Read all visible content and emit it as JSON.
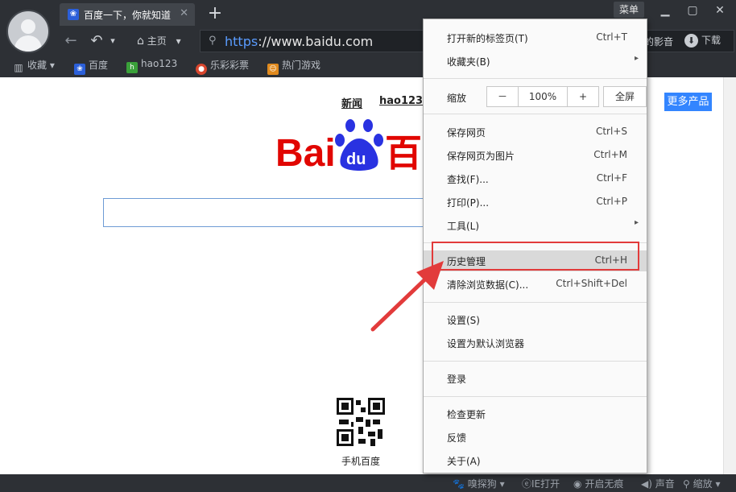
{
  "tab": {
    "title": "百度一下，你就知道",
    "close": "✕"
  },
  "newtab": "+",
  "window": {
    "menu_label": "菜单",
    "min": "▁",
    "max": "▢",
    "close": "✕"
  },
  "nav": {
    "back": "←",
    "undo": "↶",
    "undo_drop": "▾",
    "home_label": "主页",
    "home_drop": "▾"
  },
  "address": {
    "scheme": "https",
    "rest": "://www.baidu.com"
  },
  "toolbar_right": {
    "yingyin": "的影音",
    "download": "下载"
  },
  "bookmarks": [
    {
      "label": "收藏",
      "drop": "▾"
    },
    {
      "label": "百度"
    },
    {
      "label": "hao123"
    },
    {
      "label": "乐彩彩票"
    },
    {
      "label": "热门游戏"
    }
  ],
  "page": {
    "links": {
      "news": "新闻",
      "hao123": "hao123"
    },
    "more_products": "更多产品",
    "qr_label": "手机百度"
  },
  "menu": {
    "items": [
      {
        "label": "打开新的标签页(T)",
        "shortcut": "Ctrl+T"
      },
      {
        "label": "收藏夹(B)",
        "arrow": "▸"
      },
      {
        "label": "缩放",
        "zoom_minus": "－",
        "zoom_value": "100%",
        "zoom_plus": "+",
        "fullscreen": "全屏"
      },
      {
        "label": "保存网页",
        "shortcut": "Ctrl+S"
      },
      {
        "label": "保存网页为图片",
        "shortcut": "Ctrl+M"
      },
      {
        "label": "查找(F)...",
        "shortcut": "Ctrl+F"
      },
      {
        "label": "打印(P)...",
        "shortcut": "Ctrl+P"
      },
      {
        "label": "工具(L)",
        "arrow": "▸"
      },
      {
        "label": "历史管理",
        "shortcut": "Ctrl+H"
      },
      {
        "label": "清除浏览数据(C)...",
        "shortcut": "Ctrl+Shift+Del"
      },
      {
        "label": "设置(S)"
      },
      {
        "label": "设置为默认浏览器"
      },
      {
        "label": "登录"
      },
      {
        "label": "检查更新"
      },
      {
        "label": "反馈"
      },
      {
        "label": "关于(A)"
      }
    ]
  },
  "status": {
    "s1": "嗅探狗",
    "s1_drop": "▾",
    "s2": "IE打开",
    "s3": "开启无痕",
    "s4": "声音",
    "s5": "缩放",
    "s5_drop": "▾"
  },
  "colors": {
    "chrome_bg": "#2d3035",
    "accent_link": "#3385ff",
    "highlight_border": "#e23b3b",
    "baidu_red": "#e10601",
    "baidu_blue": "#2932e1"
  }
}
